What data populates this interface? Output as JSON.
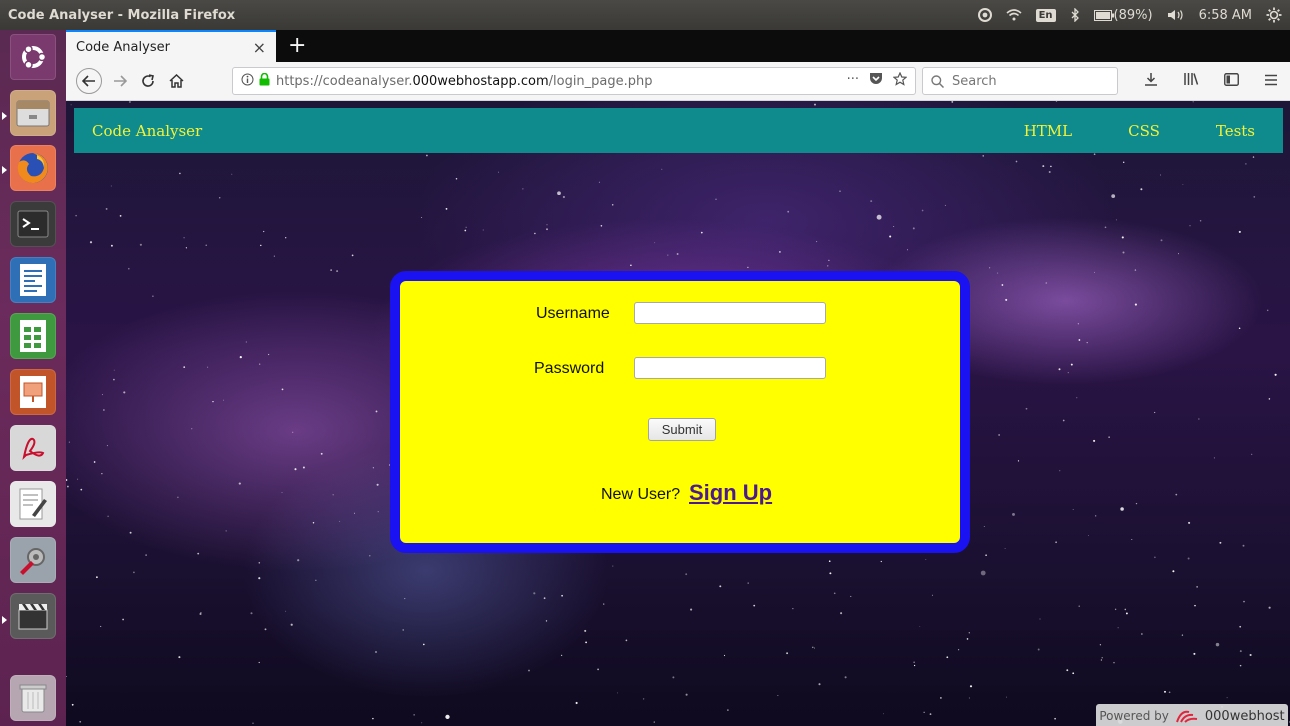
{
  "window": {
    "title": "Code Analyser - Mozilla Firefox"
  },
  "tray": {
    "keyboard": "En",
    "battery": "(89%)",
    "time": "6:58 AM"
  },
  "browser": {
    "tab_title": "Code Analyser",
    "tab_close": "×",
    "new_tab": "+",
    "url_prefix": "https://codeanalyser.",
    "url_domain": "000webhostapp.com",
    "url_path": "/login_page.php",
    "url_more": "···",
    "search_placeholder": "Search"
  },
  "site": {
    "brand": "Code Analyser",
    "nav_links": [
      "HTML",
      "CSS",
      "Tests"
    ]
  },
  "login": {
    "username_label": "Username",
    "username_value": "",
    "password_label": "Password",
    "password_value": "",
    "submit_label": "Submit",
    "new_user_label": "New User?",
    "signup_label": "Sign Up"
  },
  "footer_badge": {
    "prefix": "Powered by",
    "brand": "000webhost"
  },
  "colors": {
    "nav_bg": "#0f8b8d",
    "nav_text": "#f2f23a",
    "card_bg": "#ffff00",
    "card_border": "#1a12f0",
    "signup_link": "#4b1a8c",
    "launcher": "#6b2b5c"
  },
  "launcher_icons": [
    "ubuntu-dash-icon",
    "file-manager-icon",
    "firefox-icon",
    "terminal-icon",
    "writer-icon",
    "calc-icon",
    "impress-icon",
    "acrobat-icon",
    "text-editor-icon",
    "settings-tools-icon",
    "video-editor-icon",
    "trash-icon"
  ]
}
